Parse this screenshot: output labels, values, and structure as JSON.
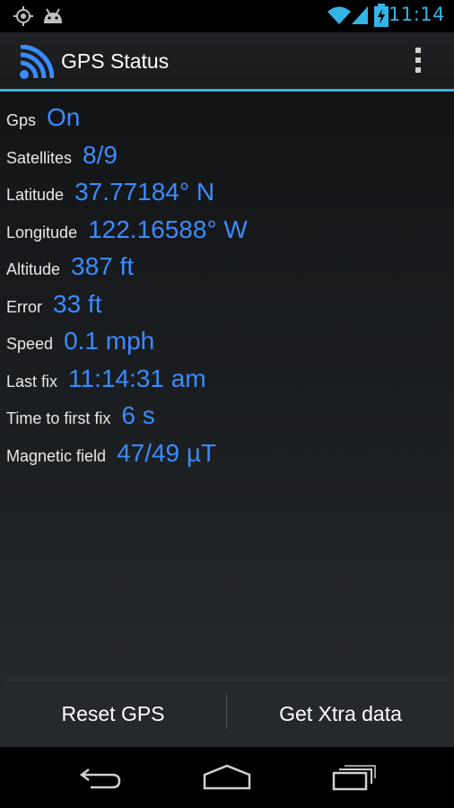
{
  "status_bar": {
    "time": "11:14",
    "icons": [
      "gps-icon",
      "android-icon",
      "wifi-icon",
      "signal-icon",
      "battery-charging-icon"
    ]
  },
  "action_bar": {
    "title": "GPS Status",
    "app_icon": "gps-signal-icon",
    "overflow_icon": "overflow-menu-icon"
  },
  "info": [
    {
      "label": "Gps",
      "value": "On"
    },
    {
      "label": "Satellites",
      "value": "8/9"
    },
    {
      "label": "Latitude",
      "value": "37.77184° N"
    },
    {
      "label": "Longitude",
      "value": "122.16588° W"
    },
    {
      "label": "Altitude",
      "value": "387 ft"
    },
    {
      "label": "Error",
      "value": "33 ft"
    },
    {
      "label": "Speed",
      "value": "0.1 mph"
    },
    {
      "label": "Last fix",
      "value": "11:14:31 am"
    },
    {
      "label": "Time to first fix",
      "value": "6 s"
    },
    {
      "label": "Magnetic field",
      "value": "47/49 µT"
    }
  ],
  "buttons": {
    "reset": "Reset GPS",
    "xtra": "Get Xtra data"
  },
  "nav": [
    "back-icon",
    "home-icon",
    "recent-apps-icon"
  ],
  "colors": {
    "accent": "#33b5e5",
    "value": "#3a8cff"
  }
}
